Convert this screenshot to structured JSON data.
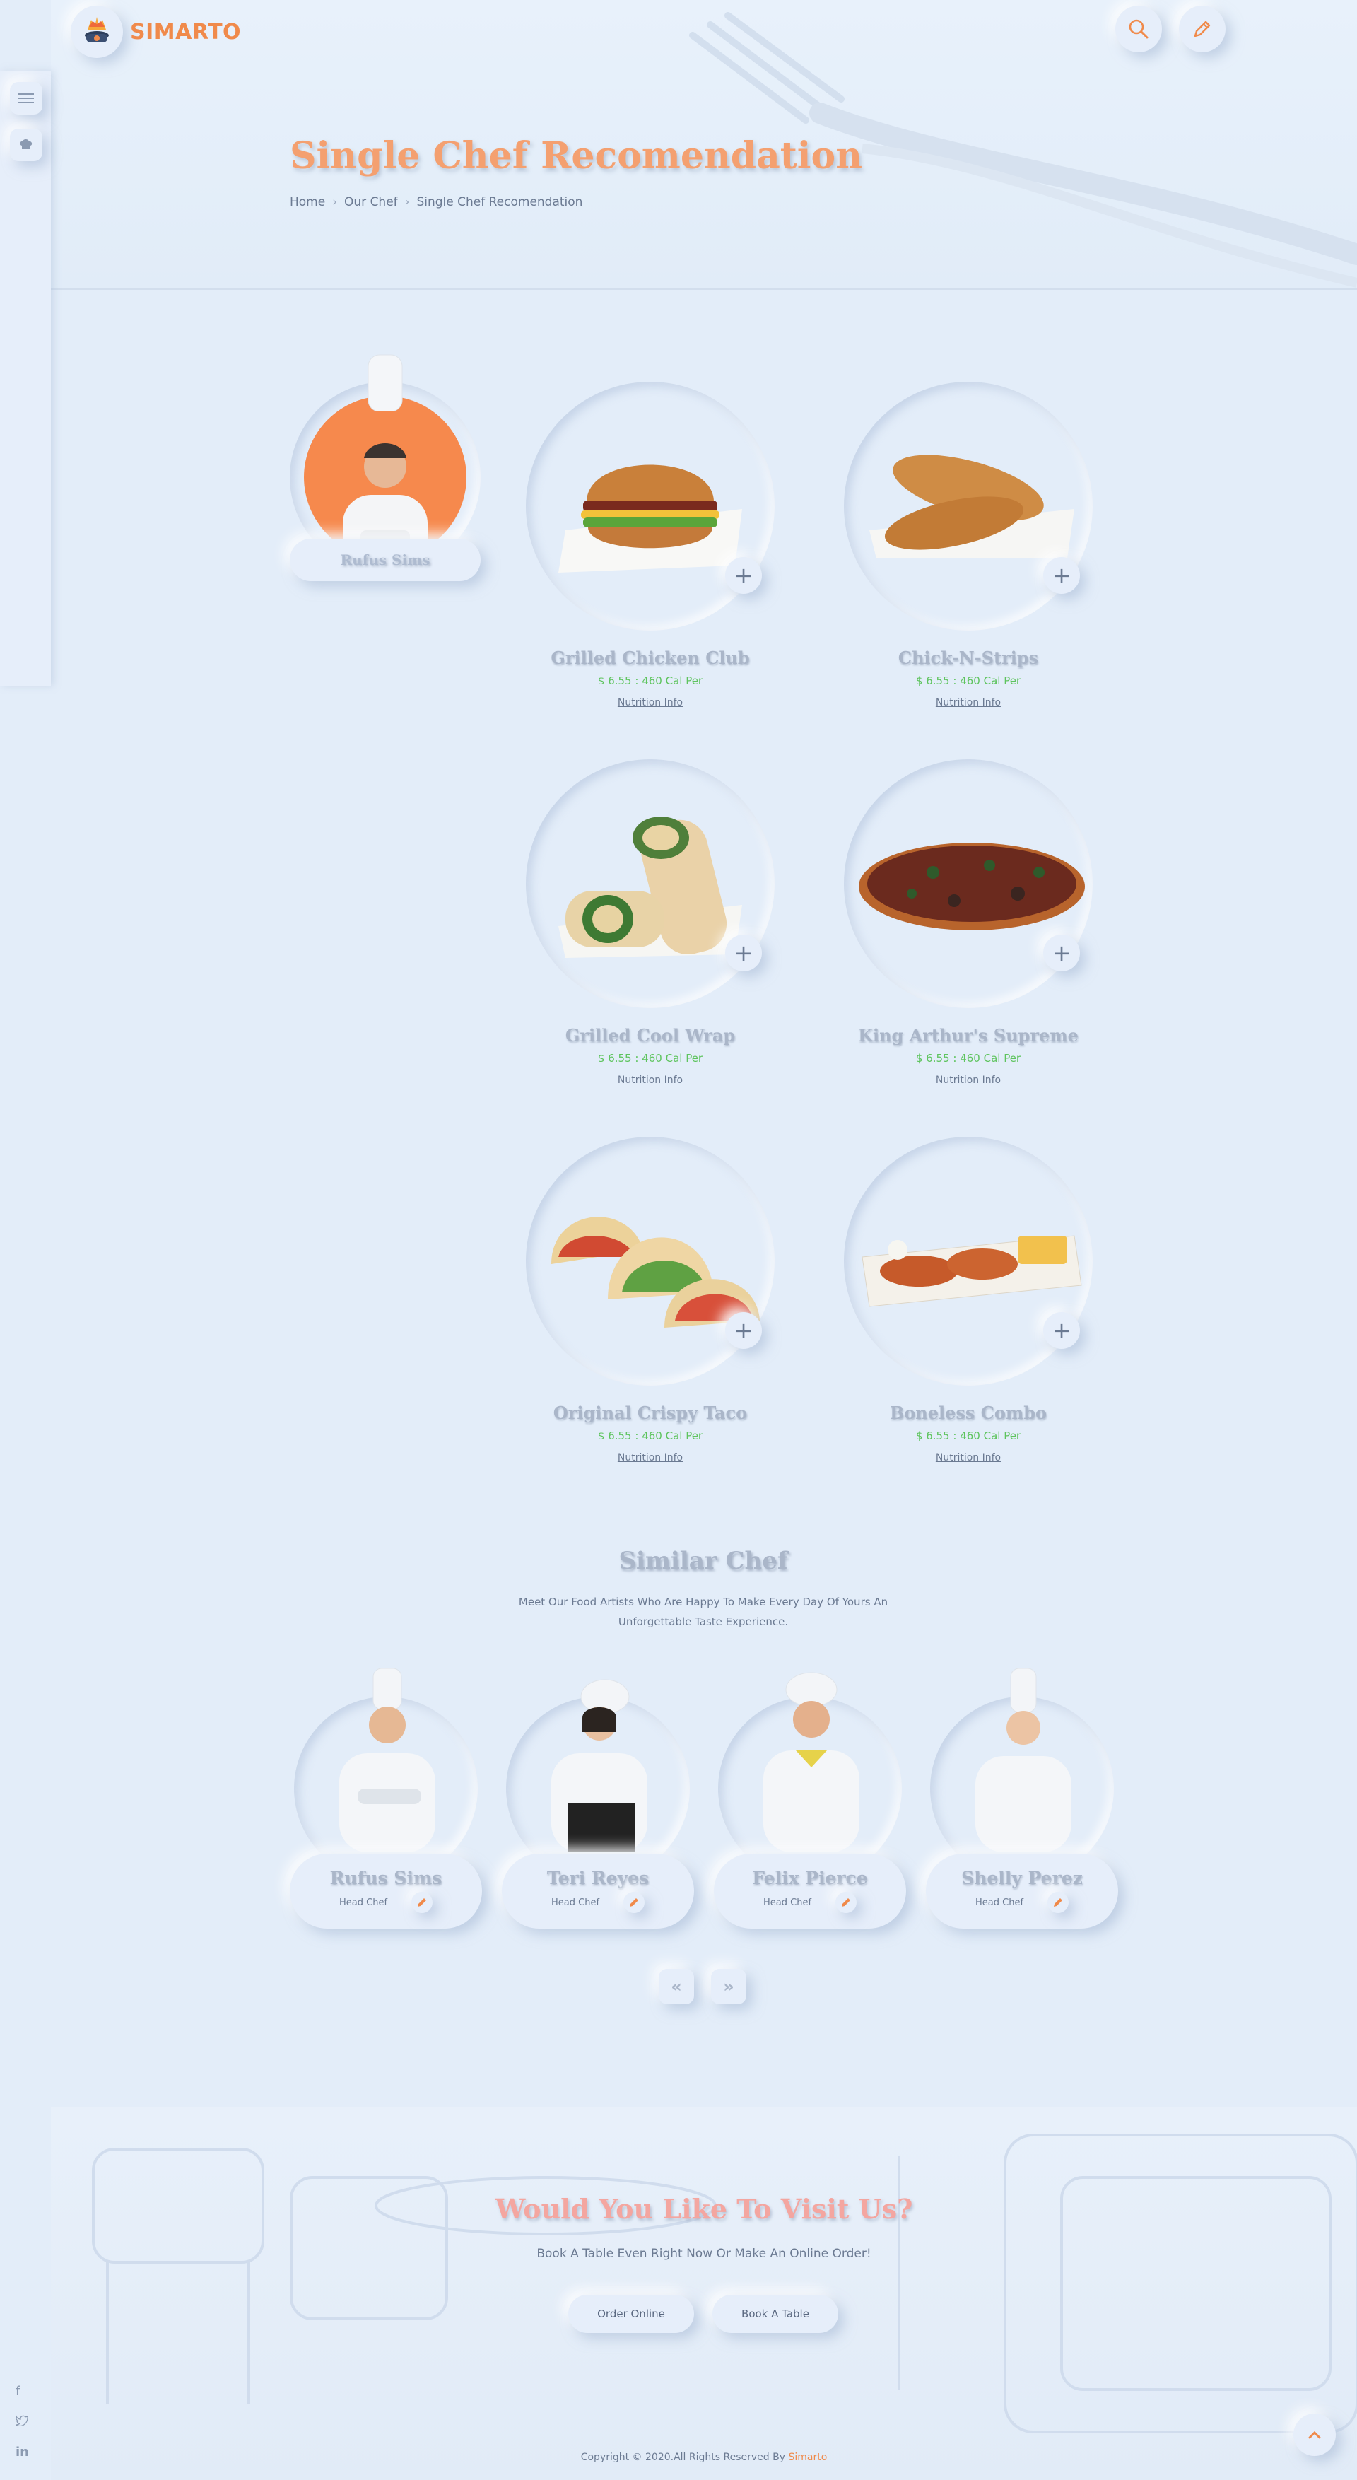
{
  "brand": {
    "name": "SIMARTO"
  },
  "header": {
    "title": "Single Chef Recomendation",
    "breadcrumbs": [
      "Home",
      "Our Chef",
      "Single Chef Recomendation"
    ]
  },
  "chef": {
    "name": "Rufus Sims"
  },
  "foods": [
    {
      "name": "Grilled Chicken Club",
      "price": "$ 6.55 : 460 Cal Per",
      "link": "Nutrition Info"
    },
    {
      "name": "Chick-N-Strips",
      "price": "$ 6.55 : 460 Cal Per",
      "link": "Nutrition Info"
    },
    {
      "name": "Grilled Cool Wrap",
      "price": "$ 6.55 : 460 Cal Per",
      "link": "Nutrition Info"
    },
    {
      "name": "King Arthur's Supreme",
      "price": "$ 6.55 : 460 Cal Per",
      "link": "Nutrition Info"
    },
    {
      "name": "Original Crispy Taco",
      "price": "$ 6.55 : 460 Cal Per",
      "link": "Nutrition Info"
    },
    {
      "name": "Boneless Combo",
      "price": "$ 6.55 : 460 Cal Per",
      "link": "Nutrition Info"
    }
  ],
  "similar": {
    "title": "Similar Chef",
    "subtitle": "Meet Our Food Artists Who Are Happy To Make Every Day Of Yours An Unforgettable Taste Experience.",
    "chefs": [
      {
        "name": "Rufus Sims",
        "role": "Head Chef"
      },
      {
        "name": "Teri Reyes",
        "role": "Head Chef"
      },
      {
        "name": "Felix Pierce",
        "role": "Head Chef"
      },
      {
        "name": "Shelly Perez",
        "role": "Head Chef"
      }
    ],
    "prev": "«",
    "next": "»"
  },
  "visit": {
    "title": "Would You Like To Visit Us?",
    "subtitle": "Book A Table Even Right Now Or Make An Online Order!",
    "order_label": "Order Online",
    "book_label": "Book A Table"
  },
  "footer": {
    "copyright": "Copyright © 2020.All Rights Reserved By",
    "brand": "Simarto"
  },
  "colors": {
    "accent": "#f08a4b",
    "background": "#e3edf9",
    "price": "#5ec45e",
    "title": "#f4a070"
  },
  "icons": {
    "search": "search-icon",
    "edit": "pencil-icon",
    "menu": "menu-icon",
    "chef": "chef-hat-icon",
    "plus": "plus-icon",
    "to_top": "chevron-up-icon"
  }
}
